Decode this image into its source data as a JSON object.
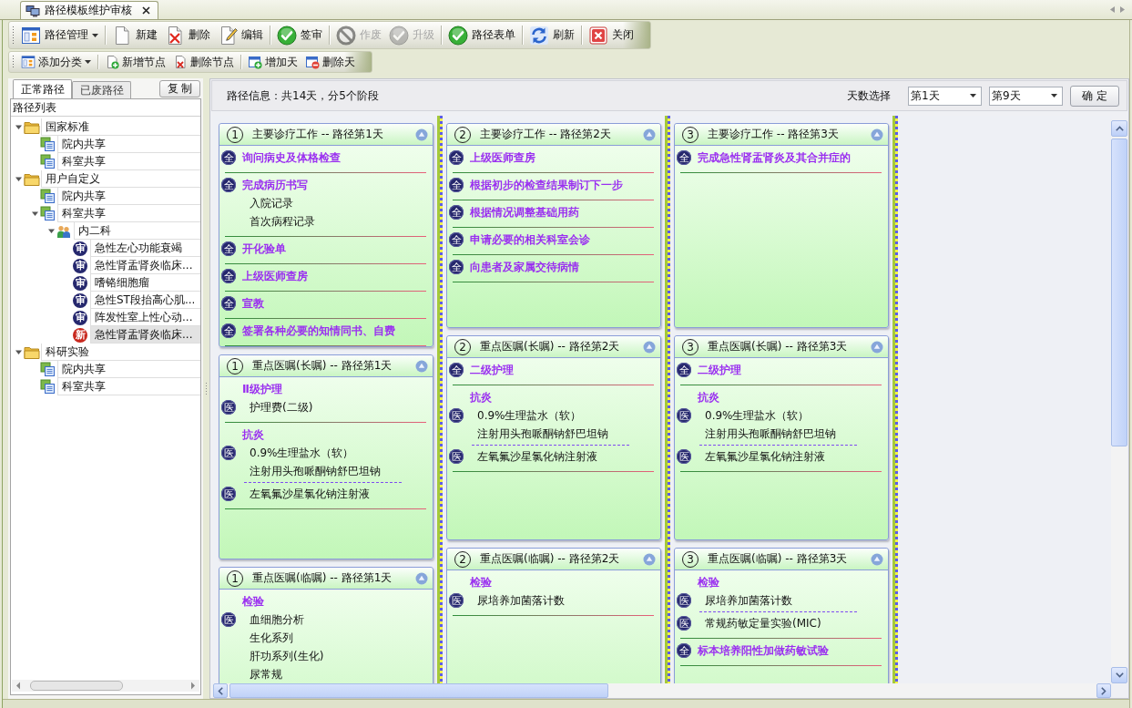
{
  "tab": {
    "title": "路径模板维护审核"
  },
  "toolbars": [
    {
      "groups": [
        [
          {
            "label": "路径管理",
            "kind": "menu",
            "disabled": false
          }
        ],
        [
          {
            "label": "新建",
            "kind": "button",
            "disabled": false
          },
          {
            "label": "删除",
            "kind": "button",
            "disabled": false
          },
          {
            "label": "编辑",
            "kind": "button",
            "disabled": false
          }
        ],
        [
          {
            "label": "签审",
            "kind": "button",
            "disabled": false
          }
        ],
        [
          {
            "label": "作废",
            "kind": "button",
            "disabled": true
          },
          {
            "label": "升级",
            "kind": "button",
            "disabled": true
          }
        ],
        [
          {
            "label": "路径表单",
            "kind": "button",
            "disabled": false
          }
        ],
        [
          {
            "label": "刷新",
            "kind": "button",
            "disabled": false
          }
        ],
        [
          {
            "label": "关闭",
            "kind": "button",
            "disabled": false
          }
        ]
      ]
    },
    {
      "groups": [
        [
          {
            "label": "添加分类",
            "kind": "menu",
            "disabled": false
          }
        ],
        [
          {
            "label": "新增节点",
            "kind": "button",
            "disabled": false
          },
          {
            "label": "删除节点",
            "kind": "button",
            "disabled": false
          }
        ],
        [
          {
            "label": "增加天",
            "kind": "button",
            "disabled": false
          },
          {
            "label": "删除天",
            "kind": "button",
            "disabled": false
          }
        ]
      ]
    }
  ],
  "left_panel": {
    "tabs": [
      {
        "label": "正常路径",
        "selected": true
      },
      {
        "label": "已废路径",
        "selected": false
      }
    ],
    "copy_button": "复 制",
    "tree": {
      "header": "路径列表",
      "items": [
        {
          "label": "国家标准",
          "kind": "folder",
          "expanded": true,
          "selected": false,
          "children": [
            {
              "label": "院内共享",
              "kind": "share",
              "selected": false
            },
            {
              "label": "科室共享",
              "kind": "share",
              "selected": false
            }
          ]
        },
        {
          "label": "用户自定义",
          "kind": "folder",
          "expanded": true,
          "selected": false,
          "children": [
            {
              "label": "院内共享",
              "kind": "share",
              "selected": false
            },
            {
              "label": "科室共享",
              "kind": "share",
              "expanded": true,
              "selected": false,
              "children": [
                {
                  "label": "内二科",
                  "kind": "department",
                  "expanded": true,
                  "selected": false,
                  "children": [
                    {
                      "label": "急性左心功能衰竭",
                      "kind": "path",
                      "badge": "审",
                      "color": "#26286e",
                      "selected": false
                    },
                    {
                      "label": "急性肾盂肾炎临床...",
                      "kind": "path",
                      "badge": "审",
                      "color": "#26286e",
                      "selected": false
                    },
                    {
                      "label": "嗜铬细胞瘤",
                      "kind": "path",
                      "badge": "审",
                      "color": "#26286e",
                      "selected": false
                    },
                    {
                      "label": "急性ST段抬高心肌...",
                      "kind": "path",
                      "badge": "审",
                      "color": "#26286e",
                      "selected": false
                    },
                    {
                      "label": "阵发性室上性心动...",
                      "kind": "path",
                      "badge": "审",
                      "color": "#26286e",
                      "selected": false
                    },
                    {
                      "label": "急性肾盂肾炎临床...",
                      "kind": "path",
                      "badge": "新",
                      "color": "#c8281e",
                      "selected": true
                    }
                  ]
                }
              ]
            }
          ]
        },
        {
          "label": "科研实验",
          "kind": "folder",
          "expanded": true,
          "selected": false,
          "children": [
            {
              "label": "院内共享",
              "kind": "share",
              "selected": false
            },
            {
              "label": "科室共享",
              "kind": "share",
              "selected": false
            }
          ]
        }
      ]
    }
  },
  "path_info": {
    "summary": "路径信息：共14天，分5个阶段",
    "day_label": "天数选择",
    "start_day": "第1天",
    "end_day": "第9天",
    "confirm_button": "确 定"
  },
  "columns": [
    {
      "cards": [
        {
          "number": "1",
          "title": "主要诊疗工作 -- 路径第1天",
          "groups": [
            {
              "kind": "task",
              "badge": "全",
              "label": "询问病史及体格检查"
            },
            {
              "kind": "task",
              "badge": "全",
              "label": "完成病历书写",
              "lines": [
                "入院记录",
                "首次病程记录"
              ]
            },
            {
              "kind": "task",
              "badge": "全",
              "label": "开化验单"
            },
            {
              "kind": "task",
              "badge": "全",
              "label": "上级医师查房"
            },
            {
              "kind": "task",
              "badge": "全",
              "label": "宣教"
            },
            {
              "kind": "task",
              "badge": "全",
              "label": "签署各种必要的知情同书、自费"
            }
          ]
        },
        {
          "number": "1",
          "title": "重点医嘱(长嘱) -- 路径第1天",
          "groups": [
            {
              "kind": "orders",
              "label": "Ⅱ级护理",
              "orders": [
                {
                  "badge": "医",
                  "lines": [
                    "护理费(二级)"
                  ]
                }
              ]
            },
            {
              "kind": "orders",
              "label": "抗炎",
              "orders": [
                {
                  "badge": "医",
                  "lines": [
                    "0.9%生理盐水（软）",
                    "注射用头孢哌酮钠舒巴坦钠"
                  ]
                },
                {
                  "badge": "医",
                  "lines": [
                    "左氧氟沙星氯化钠注射液"
                  ]
                }
              ]
            }
          ]
        },
        {
          "number": "1",
          "title": "重点医嘱(临嘱) -- 路径第1天",
          "groups": [
            {
              "kind": "orders",
              "label": "检验",
              "orders": [
                {
                  "badge": "医",
                  "lines": [
                    "血细胞分析",
                    "生化系列",
                    "肝功系列(生化)",
                    "尿常规"
                  ]
                }
              ]
            }
          ]
        }
      ]
    },
    {
      "cards": [
        {
          "number": "2",
          "title": "主要诊疗工作 -- 路径第2天",
          "groups": [
            {
              "kind": "task",
              "badge": "全",
              "label": "上级医师查房"
            },
            {
              "kind": "task",
              "badge": "全",
              "label": "根据初步的检查结果制订下一步"
            },
            {
              "kind": "task",
              "badge": "全",
              "label": "根据情况调整基础用药"
            },
            {
              "kind": "task",
              "badge": "全",
              "label": "申请必要的相关科室会诊"
            },
            {
              "kind": "task",
              "badge": "全",
              "label": "向患者及家属交待病情"
            }
          ]
        },
        {
          "number": "2",
          "title": "重点医嘱(长嘱) -- 路径第2天",
          "groups": [
            {
              "kind": "task",
              "badge": "全",
              "label": "二级护理"
            },
            {
              "kind": "orders",
              "label": "抗炎",
              "orders": [
                {
                  "badge": "医",
                  "lines": [
                    "0.9%生理盐水（软）",
                    "注射用头孢哌酮钠舒巴坦钠"
                  ]
                },
                {
                  "badge": "医",
                  "lines": [
                    "左氧氟沙星氯化钠注射液"
                  ]
                }
              ]
            }
          ]
        },
        {
          "number": "2",
          "title": "重点医嘱(临嘱) -- 路径第2天",
          "groups": [
            {
              "kind": "orders",
              "label": "检验",
              "orders": [
                {
                  "badge": "医",
                  "lines": [
                    "尿培养加菌落计数"
                  ]
                }
              ]
            }
          ]
        }
      ]
    },
    {
      "cards": [
        {
          "number": "3",
          "title": "主要诊疗工作 -- 路径第3天",
          "groups": [
            {
              "kind": "task",
              "badge": "全",
              "label": "完成急性肾盂肾炎及其合并症的"
            }
          ]
        },
        {
          "number": "3",
          "title": "重点医嘱(长嘱) -- 路径第3天",
          "groups": [
            {
              "kind": "task",
              "badge": "全",
              "label": "二级护理"
            },
            {
              "kind": "orders",
              "label": "抗炎",
              "orders": [
                {
                  "badge": "医",
                  "lines": [
                    "0.9%生理盐水（软）",
                    "注射用头孢哌酮钠舒巴坦钠"
                  ]
                },
                {
                  "badge": "医",
                  "lines": [
                    "左氧氟沙星氯化钠注射液"
                  ]
                }
              ]
            }
          ]
        },
        {
          "number": "3",
          "title": "重点医嘱(临嘱) -- 路径第3天",
          "groups": [
            {
              "kind": "orders",
              "label": "检验",
              "orders": [
                {
                  "badge": "医",
                  "lines": [
                    "尿培养加菌落计数"
                  ]
                },
                {
                  "badge": "医",
                  "lines": [
                    "常规药敏定量实验(MIC)"
                  ]
                }
              ]
            },
            {
              "kind": "task",
              "badge": "全",
              "label": "标本培养阳性加做药敏试验"
            }
          ]
        }
      ]
    }
  ]
}
